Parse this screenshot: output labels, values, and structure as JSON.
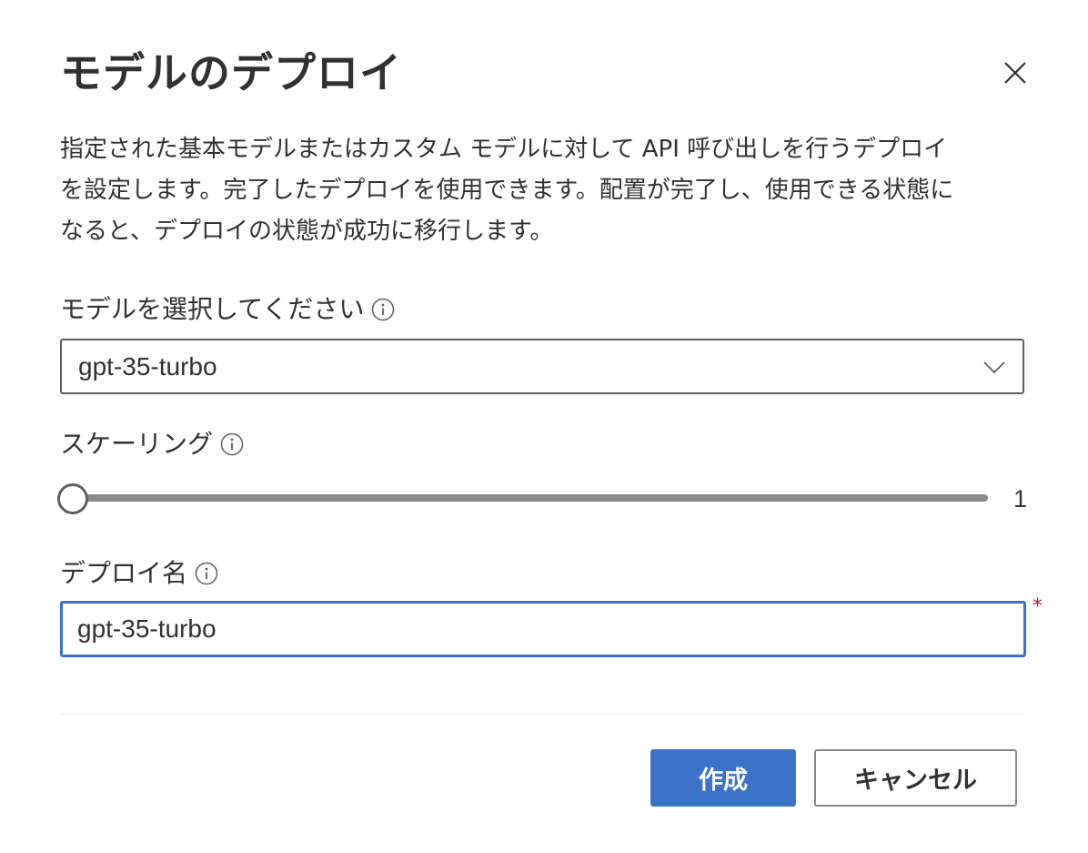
{
  "dialog": {
    "title": "モデルのデプロイ",
    "description": "指定された基本モデルまたはカスタム モデルに対して API 呼び出しを行うデプロイ\nを設定します。完了したデプロイを使用できます。配置が完了し、使用できる状態に\nなると、デプロイの状態が成功に移行します。"
  },
  "model_field": {
    "label": "モデルを選択してください",
    "selected_value": "gpt-35-turbo"
  },
  "scaling_field": {
    "label": "スケーリング",
    "value": 1,
    "value_text": "1",
    "min": 1,
    "max": 1
  },
  "deploy_name_field": {
    "label": "デプロイ名",
    "value": "gpt-35-turbo",
    "required_mark": "*"
  },
  "buttons": {
    "create_label": "作成",
    "cancel_label": "キャンセル"
  },
  "icons": {
    "close": "close-icon",
    "info": "info-icon",
    "chevron": "chevron-down-icon"
  },
  "colors": {
    "primary": "#3a73c8",
    "text": "#323130",
    "required": "#a4262c",
    "border": "#605e5c"
  }
}
